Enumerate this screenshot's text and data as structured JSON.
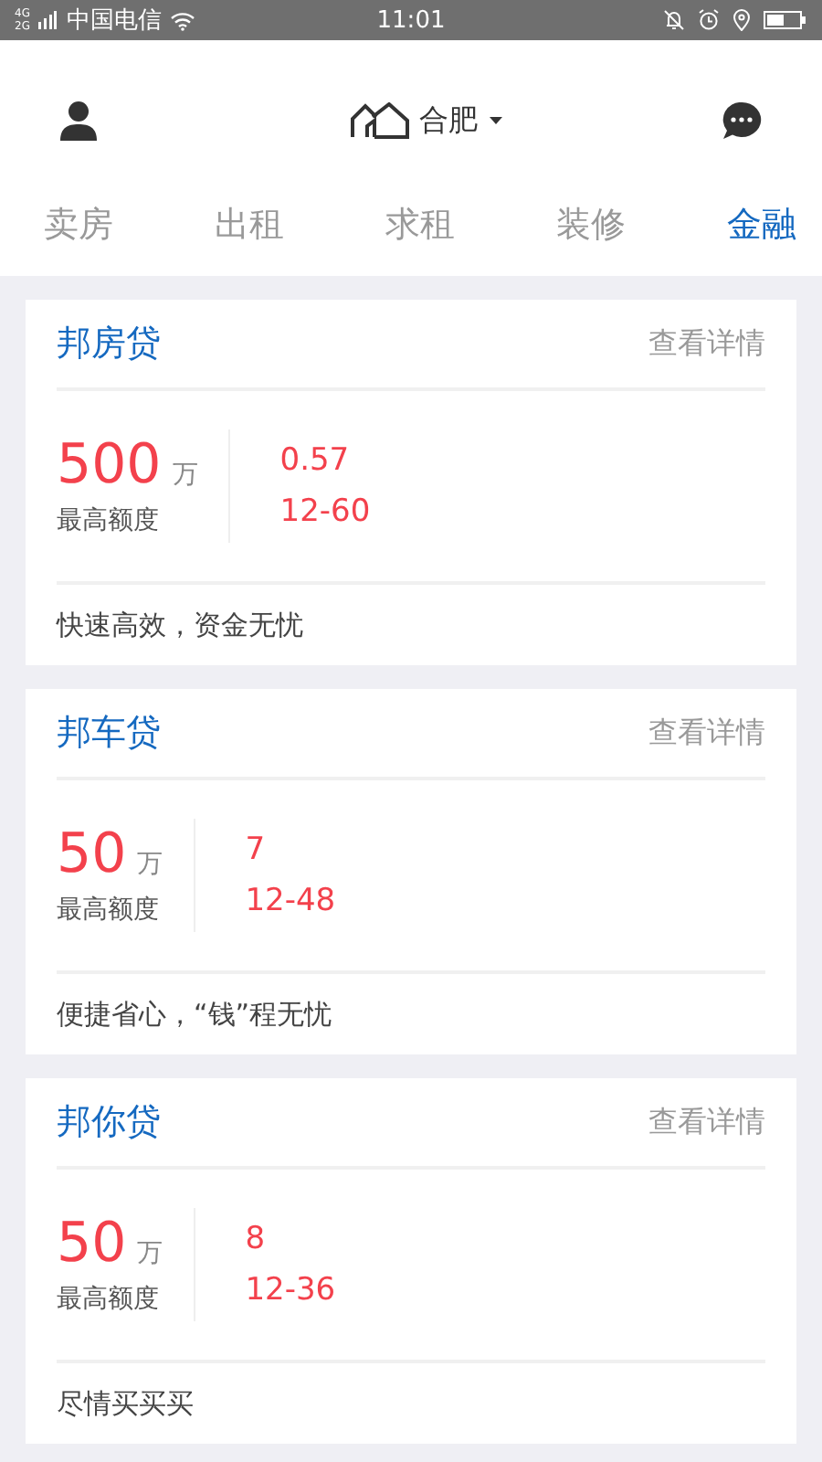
{
  "status_bar": {
    "network_top": "4G",
    "network_bottom": "2G",
    "carrier": "中国电信",
    "time": "11:01"
  },
  "header": {
    "city": "合肥"
  },
  "tabs": [
    {
      "label": "卖房",
      "selected": false
    },
    {
      "label": "出租",
      "selected": false
    },
    {
      "label": "求租",
      "selected": false
    },
    {
      "label": "装修",
      "selected": false
    },
    {
      "label": "金融",
      "selected": true
    }
  ],
  "cards": [
    {
      "title": "邦房贷",
      "link": "查看详情",
      "amount": "500",
      "unit": "万",
      "amount_label": "最高额度",
      "value_1": "0.57",
      "value_2": "12-60",
      "slogan": "快速高效，资金无忧"
    },
    {
      "title": "邦车贷",
      "link": "查看详情",
      "amount": "50",
      "unit": "万",
      "amount_label": "最高额度",
      "value_1": "7",
      "value_2": "12-48",
      "slogan": "便捷省心，“钱”程无忧"
    },
    {
      "title": "邦你贷",
      "link": "查看详情",
      "amount": "50",
      "unit": "万",
      "amount_label": "最高额度",
      "value_1": "8",
      "value_2": "12-36",
      "slogan": "尽情买买买"
    }
  ]
}
